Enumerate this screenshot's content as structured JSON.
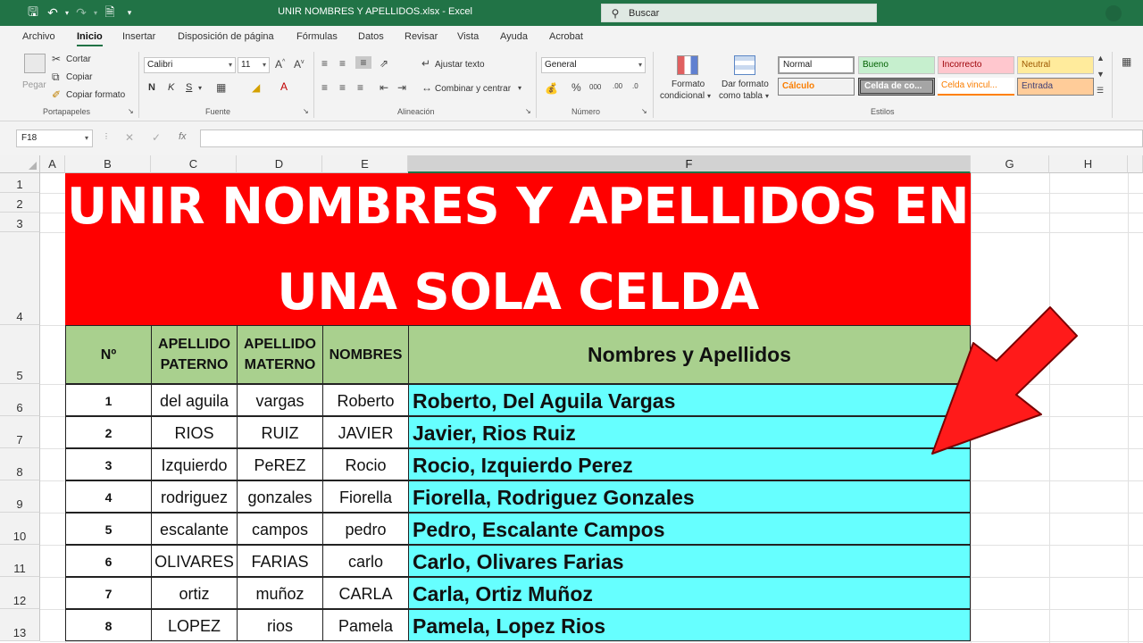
{
  "window": {
    "title": "UNIR NOMBRES Y APELLIDOS.xlsx  -  Excel",
    "search_placeholder": "Buscar"
  },
  "menu": {
    "tabs": [
      "Archivo",
      "Inicio",
      "Insertar",
      "Disposición de página",
      "Fórmulas",
      "Datos",
      "Revisar",
      "Vista",
      "Ayuda",
      "Acrobat"
    ],
    "active": "Inicio"
  },
  "ribbon": {
    "clipboard": {
      "paste": "Pegar",
      "cut": "Cortar",
      "copy": "Copiar",
      "format_painter": "Copiar formato",
      "group": "Portapapeles"
    },
    "font": {
      "name": "Calibri",
      "size": "11",
      "bold": "N",
      "italic": "K",
      "underline": "S",
      "group": "Fuente"
    },
    "alignment": {
      "wrap": "Ajustar texto",
      "merge": "Combinar y centrar",
      "group": "Alineación"
    },
    "number": {
      "format": "General",
      "group": "Número"
    },
    "styles": {
      "cond_format_1": "Formato",
      "cond_format_2": "condicional",
      "table_format_1": "Dar formato",
      "table_format_2": "como tabla",
      "cells": [
        "Normal",
        "Bueno",
        "Incorrecto",
        "Neutral",
        "Cálculo",
        "Celda de co...",
        "Celda vincul...",
        "Entrada"
      ],
      "group": "Estilos"
    }
  },
  "formula_bar": {
    "name_box": "F18",
    "fx": "fx",
    "content": ""
  },
  "columns": [
    "A",
    "B",
    "C",
    "D",
    "E",
    "F",
    "G",
    "H"
  ],
  "rows": [
    "1",
    "2",
    "3",
    "4",
    "5",
    "6",
    "7",
    "8",
    "9",
    "10",
    "11",
    "12",
    "13"
  ],
  "sheet": {
    "title_line1": "UNIR NOMBRES Y APELLIDOS EN",
    "title_line2": "UNA SOLA CELDA",
    "headers": {
      "num": "Nº",
      "paterno_1": "APELLIDO",
      "paterno_2": "PATERNO",
      "materno_1": "APELLIDO",
      "materno_2": "MATERNO",
      "nombres": "NOMBRES",
      "result": "Nombres y Apellidos"
    },
    "records": [
      {
        "n": "1",
        "paterno": "del aguila",
        "materno": "vargas",
        "nombre": "Roberto",
        "resultado": "Roberto, Del Aguila Vargas"
      },
      {
        "n": "2",
        "paterno": "RIOS",
        "materno": "RUIZ",
        "nombre": "JAVIER",
        "resultado": "Javier, Rios Ruiz"
      },
      {
        "n": "3",
        "paterno": "Izquierdo",
        "materno": "PeREZ",
        "nombre": "Rocio",
        "resultado": "Rocio, Izquierdo Perez"
      },
      {
        "n": "4",
        "paterno": "rodriguez",
        "materno": "gonzales",
        "nombre": "Fiorella",
        "resultado": "Fiorella, Rodriguez Gonzales"
      },
      {
        "n": "5",
        "paterno": "escalante",
        "materno": "campos",
        "nombre": "pedro",
        "resultado": "Pedro, Escalante Campos"
      },
      {
        "n": "6",
        "paterno": "OLIVARES",
        "materno": "FARIAS",
        "nombre": "carlo",
        "resultado": "Carlo, Olivares Farias"
      },
      {
        "n": "7",
        "paterno": "ortiz",
        "materno": "muñoz",
        "nombre": "CARLA",
        "resultado": "Carla, Ortiz Muñoz"
      },
      {
        "n": "8",
        "paterno": "LOPEZ",
        "materno": "rios",
        "nombre": "Pamela",
        "resultado": "Pamela, Lopez Rios"
      }
    ]
  },
  "colors": {
    "excel_green": "#217346",
    "banner_red": "#ff0000",
    "header_green": "#a9d08e",
    "result_cyan": "#66ffff",
    "arrow_red": "#ff1a1a"
  }
}
